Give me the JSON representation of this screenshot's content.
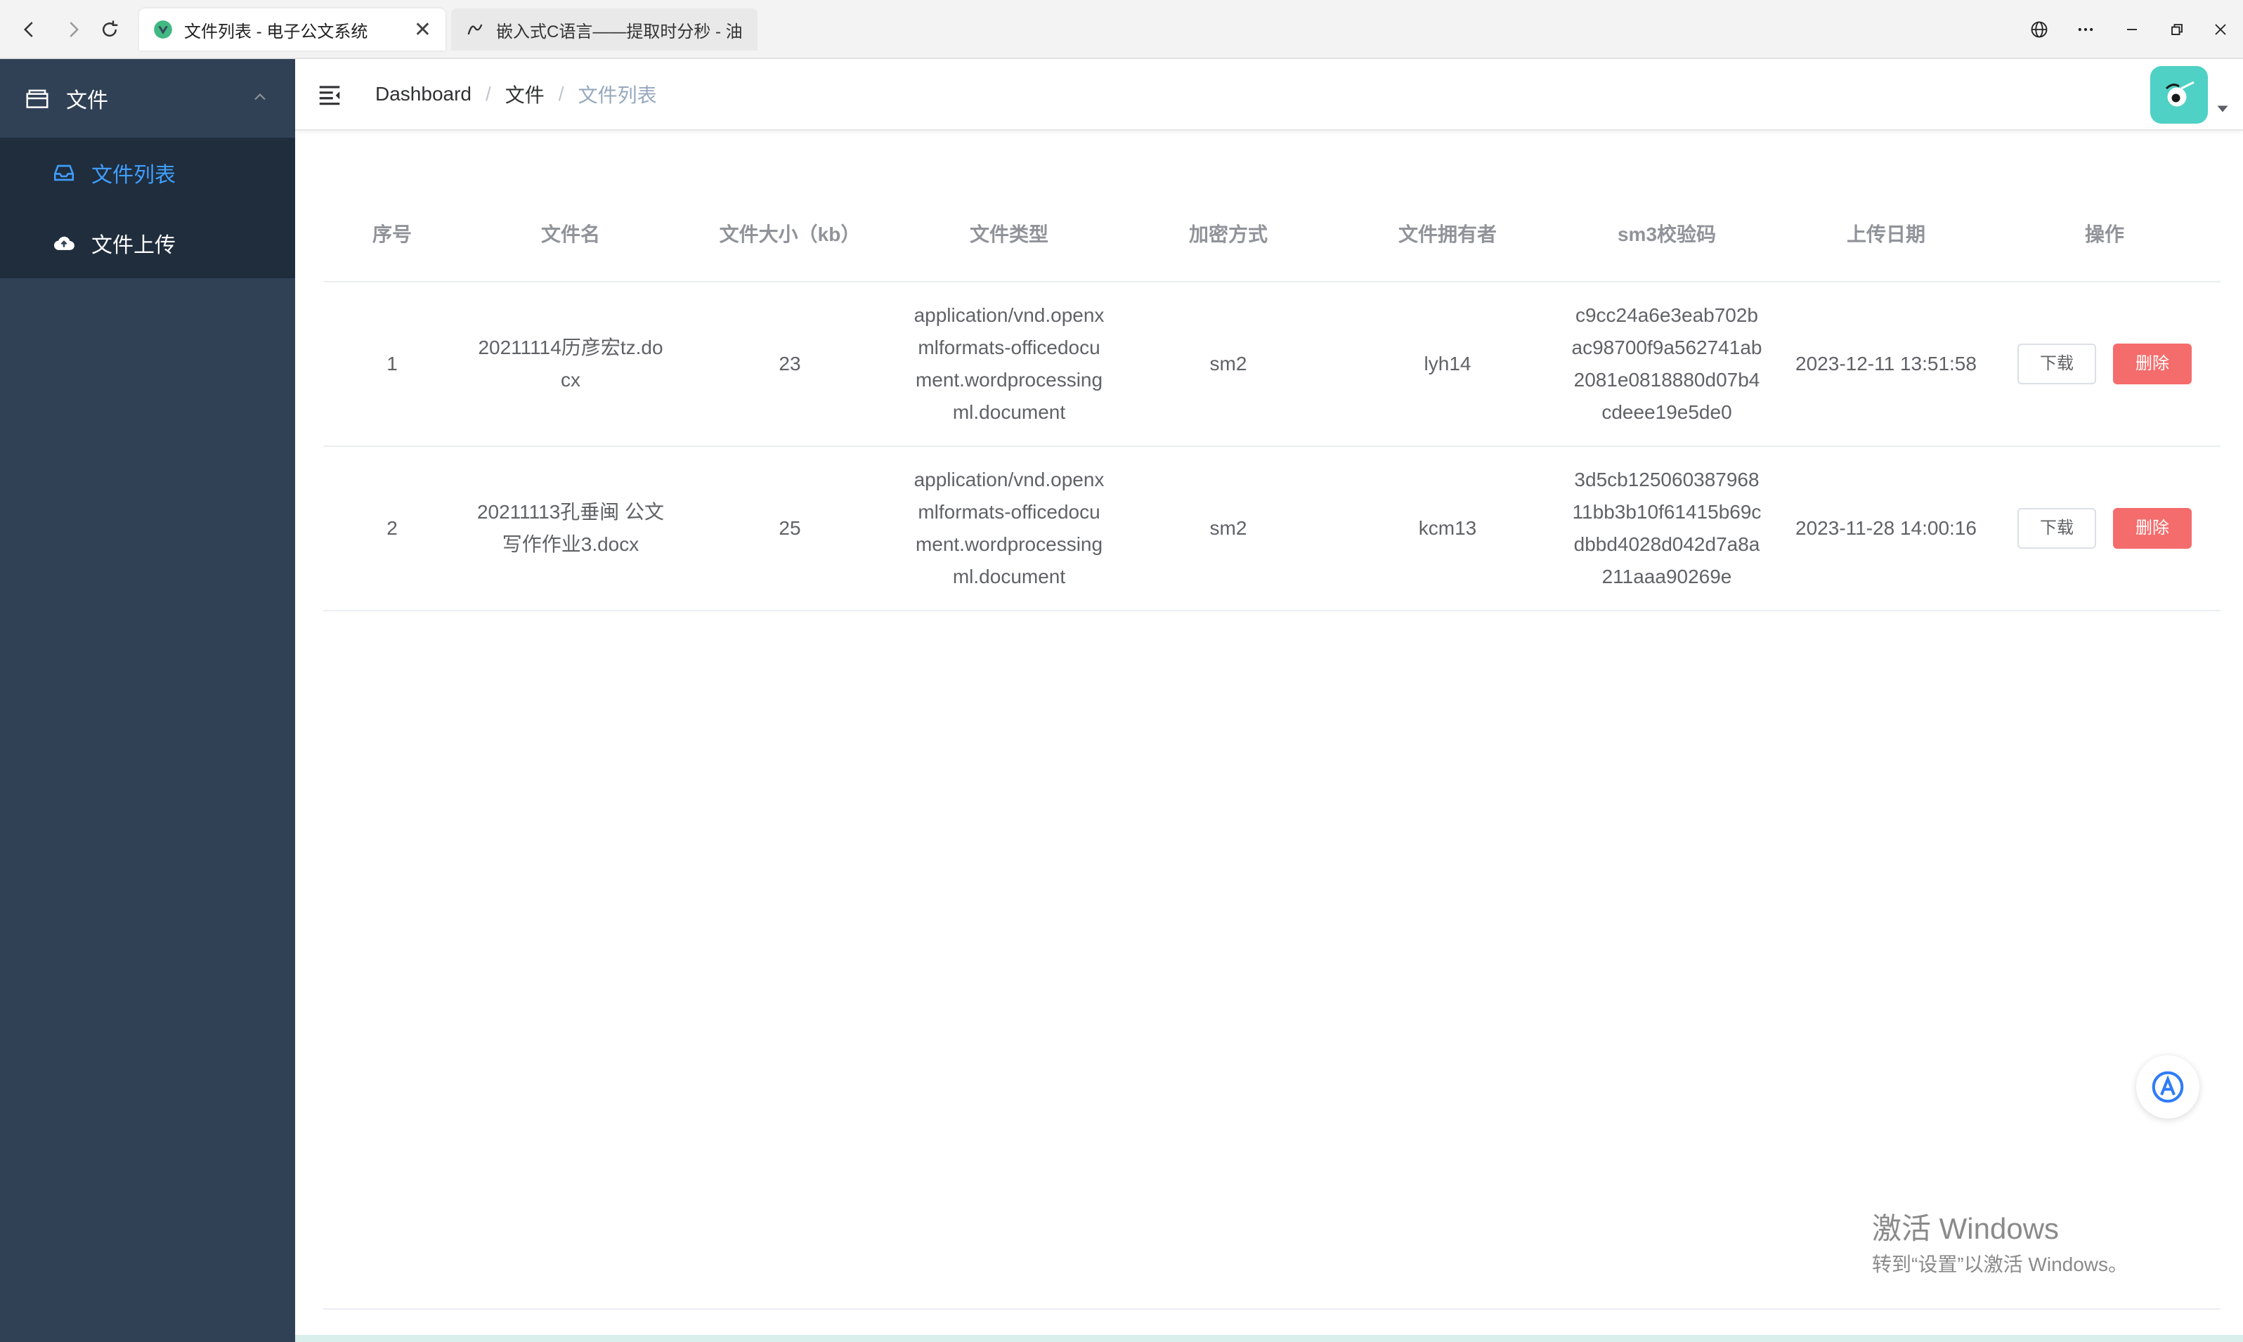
{
  "browser": {
    "tabs": [
      {
        "title": "文件列表 - 电子公文系统",
        "active": true
      },
      {
        "title": "嵌入式C语言——提取时分秒 - 油墨",
        "active": false
      }
    ],
    "close_glyph": "✕"
  },
  "sidebar": {
    "group_label": "文件",
    "items": [
      {
        "label": "文件列表",
        "active": true,
        "icon": "inbox-icon"
      },
      {
        "label": "文件上传",
        "active": false,
        "icon": "cloud-upload-icon"
      }
    ]
  },
  "breadcrumb": {
    "items": [
      "Dashboard",
      "文件",
      "文件列表"
    ],
    "separator": "/"
  },
  "table": {
    "headers": [
      "序号",
      "文件名",
      "文件大小（kb）",
      "文件类型",
      "加密方式",
      "文件拥有者",
      "sm3校验码",
      "上传日期",
      "操作"
    ],
    "rows": [
      {
        "index": "1",
        "name": "20211114历彦宏tz.docx",
        "size": "23",
        "type": "application/vnd.openxmlformats-officedocument.wordprocessingml.document",
        "encryption": "sm2",
        "owner": "lyh14",
        "sm3": "c9cc24a6e3eab702bac98700f9a562741ab2081e0818880d07b4cdeee19e5de0",
        "date": "2023-12-11 13:51:58"
      },
      {
        "index": "2",
        "name": "20211113孔垂闽 公文写作作业3.docx",
        "size": "25",
        "type": "application/vnd.openxmlformats-officedocument.wordprocessingml.document",
        "encryption": "sm2",
        "owner": "kcm13",
        "sm3": "3d5cb12506038796811bb3b10f61415b69cdbbd4028d042d7a8a211aaa90269e",
        "date": "2023-11-28 14:00:16"
      }
    ],
    "download_label": "下载",
    "delete_label": "删除"
  },
  "watermark": {
    "line1": "激活 Windows",
    "line2": "转到“设置”以激活 Windows。"
  },
  "colors": {
    "sidebar_bg": "#304156",
    "submenu_bg": "#1f2d3d",
    "accent": "#409eff",
    "danger": "#f56c6c"
  }
}
